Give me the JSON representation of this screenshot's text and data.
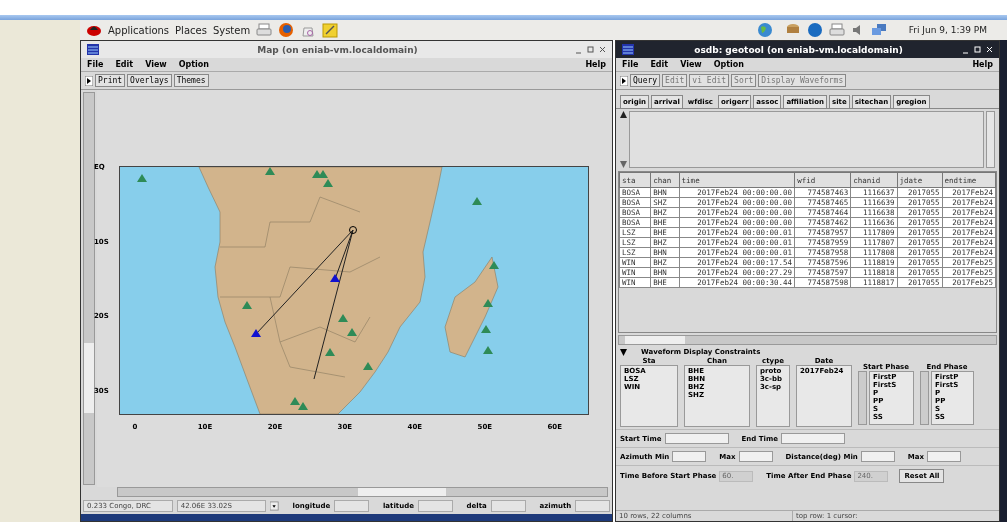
{
  "desktop_panel": {
    "menus": [
      "Applications",
      "Places",
      "System"
    ],
    "clock": "Fri Jun  9,  1:39 PM"
  },
  "map_window": {
    "title": "Map (on eniab-vm.localdomain)",
    "active": false,
    "menus": [
      "File",
      "Edit",
      "View",
      "Option"
    ],
    "help_menu": "Help",
    "toolbar": [
      "Print",
      "Overlays",
      "Themes"
    ],
    "y_ticks": [
      "EQ",
      "10S",
      "20S",
      "30S"
    ],
    "x_ticks": [
      "0",
      "10E",
      "20E",
      "30E",
      "40E",
      "50E",
      "60E"
    ],
    "status_region": "0.233 Congo, DRC",
    "status_position": "42.06E  33.02S",
    "fields": [
      "longitude",
      "latitude",
      "delta",
      "azimuth"
    ]
  },
  "geotool_window": {
    "title": "osdb: geotool (on eniab-vm.localdomain)",
    "active": true,
    "menus": [
      "File",
      "Edit",
      "View",
      "Option"
    ],
    "help_menu": "Help",
    "toolbar": [
      {
        "label": "Query",
        "disabled": false
      },
      {
        "label": "Edit",
        "disabled": true
      },
      {
        "label": "vi Edit",
        "disabled": true
      },
      {
        "label": "Sort",
        "disabled": true
      },
      {
        "label": "Display Waveforms",
        "disabled": true
      }
    ],
    "tabs": [
      {
        "label": "origin",
        "selected": false
      },
      {
        "label": "arrival",
        "selected": false
      },
      {
        "label": "wfdisc",
        "selected": true
      },
      {
        "label": "origerr",
        "selected": false
      },
      {
        "label": "assoc",
        "selected": false
      },
      {
        "label": "affiliation",
        "selected": false
      },
      {
        "label": "site",
        "selected": false
      },
      {
        "label": "sitechan",
        "selected": false
      },
      {
        "label": "gregion",
        "selected": false
      }
    ],
    "table": {
      "columns": [
        "sta",
        "chan",
        "time",
        "wfid",
        "chanid",
        "jdate",
        "endtime"
      ],
      "rows": [
        [
          "BOSA",
          "BHN",
          "2017Feb24 00:00:00.00",
          "774587463",
          "1116637",
          "2017055",
          "2017Feb24"
        ],
        [
          "BOSA",
          "SHZ",
          "2017Feb24 00:00:00.00",
          "774587465",
          "1116639",
          "2017055",
          "2017Feb24"
        ],
        [
          "BOSA",
          "BHZ",
          "2017Feb24 00:00:00.00",
          "774587464",
          "1116638",
          "2017055",
          "2017Feb24"
        ],
        [
          "BOSA",
          "BHE",
          "2017Feb24 00:00:00.00",
          "774587462",
          "1116636",
          "2017055",
          "2017Feb24"
        ],
        [
          "LSZ",
          "BHE",
          "2017Feb24 00:00:00.01",
          "774587957",
          "1117809",
          "2017055",
          "2017Feb24"
        ],
        [
          "LSZ",
          "BHZ",
          "2017Feb24 00:00:00.01",
          "774587959",
          "1117807",
          "2017055",
          "2017Feb24"
        ],
        [
          "LSZ",
          "BHN",
          "2017Feb24 00:00:00.01",
          "774587958",
          "1117808",
          "2017055",
          "2017Feb24"
        ],
        [
          "WIN",
          "BHZ",
          "2017Feb24 00:00:17.54",
          "774587596",
          "1118819",
          "2017055",
          "2017Feb25"
        ],
        [
          "WIN",
          "BHN",
          "2017Feb24 00:00:27.29",
          "774587597",
          "1118818",
          "2017055",
          "2017Feb25"
        ],
        [
          "WIN",
          "BHE",
          "2017Feb24 00:00:30.44",
          "774587598",
          "1118817",
          "2017055",
          "2017Feb25"
        ]
      ]
    },
    "constraints": {
      "title": "Waveform Display Constraints",
      "expanded": true,
      "lists": [
        {
          "label": "Sta",
          "kind": "plain",
          "items": [
            "BOSA",
            "LSZ",
            "WIN"
          ]
        },
        {
          "label": "Chan",
          "kind": "plain",
          "items": [
            "BHE",
            "BHN",
            "BHZ",
            "SHZ"
          ]
        },
        {
          "label": "ctype",
          "kind": "plain",
          "items": [
            "proto",
            "3c-bb",
            "3c-sp"
          ]
        },
        {
          "label": "Date",
          "kind": "plain",
          "items": [
            "2017Feb24"
          ]
        },
        {
          "label": "Start Phase",
          "kind": "scroll",
          "items": [
            "FirstP",
            "FirstS",
            "P",
            "PP",
            "S",
            "SS"
          ]
        },
        {
          "label": "End Phase",
          "kind": "scroll",
          "items": [
            "FirstP",
            "FirstS",
            "P",
            "PP",
            "S",
            "SS"
          ]
        }
      ]
    },
    "field_rows": [
      [
        {
          "label": "Start Time",
          "disabled": false
        },
        {
          "label": "End Time",
          "disabled": false
        }
      ],
      [
        {
          "label": "Azimuth Min",
          "disabled": false
        },
        {
          "label": "Max",
          "disabled": false
        },
        {
          "label": "Distance(deg) Min",
          "disabled": false
        },
        {
          "label": "Max",
          "disabled": false
        }
      ],
      [
        {
          "label": "Time Before Start Phase",
          "value": "60.",
          "disabled": true
        },
        {
          "label": "Time After End Phase",
          "value": "240.",
          "disabled": true
        }
      ]
    ],
    "reset_button": "Reset All",
    "status_rows": "10 rows,  22 columns",
    "status_cursor": "top row: 1  cursor:"
  }
}
